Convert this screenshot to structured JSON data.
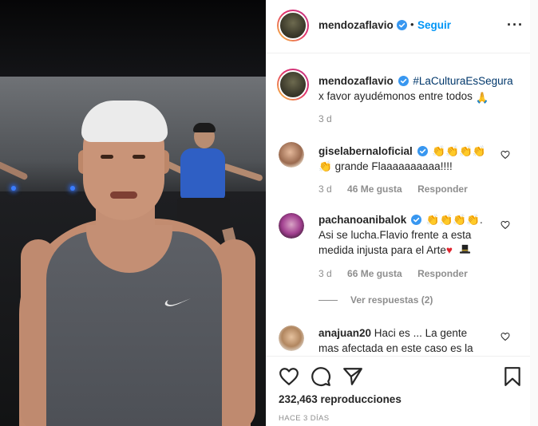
{
  "post": {
    "author": "mendozaflavio",
    "follow_label": "Seguir",
    "separator": "•",
    "caption": {
      "hashtag": "#LaCulturaEsSegura",
      "text": "x favor ayudémonos entre todos",
      "emoji": "🙏",
      "time": "3 d"
    },
    "views": "232,463 reproducciones",
    "posted_ago": "HACE 3 DÍAS"
  },
  "media": {
    "shirt_logo": "nike-swoosh",
    "description_icon": "video"
  },
  "comments": [
    {
      "user": "giselabernaloficial",
      "verified": true,
      "text_line1_emoji": "👏👏👏👏",
      "text_line2": "grande Flaaaaaaaaaa!!!!",
      "time": "3 d",
      "likes": "46 Me gusta",
      "reply": "Responder"
    },
    {
      "user": "pachanoanibalok",
      "verified": true,
      "text_line1_emoji": "👏👏👏👏.",
      "text_line2": "Asi se lucha.Flavio frente a esta",
      "text_line3": "medida injusta para el Arte",
      "time": "3 d",
      "likes": "66 Me gusta",
      "reply": "Responder",
      "view_replies": "Ver respuestas (2)"
    },
    {
      "user": "anajuan20",
      "verified": false,
      "text_line1": "Haci es ... La gente",
      "text_line2": "mas afectada en este caso es la"
    }
  ],
  "colors": {
    "accent": "#0095f6",
    "hashtag": "#00376b",
    "muted": "#8e8e8e",
    "text": "#262626",
    "heart_emoji": "#e0242e"
  },
  "icons": [
    "heart-icon",
    "comment-icon",
    "share-icon",
    "bookmark-icon",
    "verified-icon",
    "more-options-icon"
  ]
}
